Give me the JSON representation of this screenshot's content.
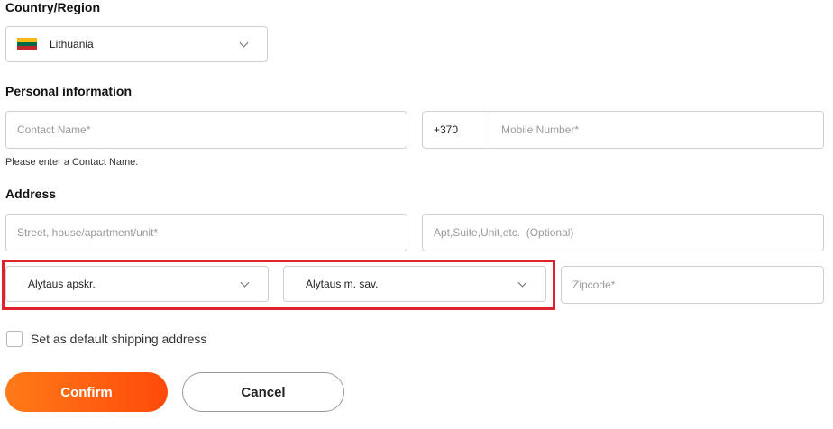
{
  "country": {
    "title": "Country/Region",
    "selected": "Lithuania",
    "flag_colors": [
      "#fdb913",
      "#006a44",
      "#c1272d"
    ]
  },
  "personal": {
    "title": "Personal information",
    "contact_name_placeholder": "Contact Name*",
    "phone_code": "+370",
    "mobile_placeholder": "Mobile Number*",
    "error_hint": "Please enter a Contact Name."
  },
  "address": {
    "title": "Address",
    "street_placeholder": "Street, house/apartment/unit*",
    "apt_placeholder": "Apt,Suite,Unit,etc.  (Optional)",
    "county_selected": "Alytaus apskr.",
    "municipality_selected": "Alytaus m. sav.",
    "zipcode_placeholder": "Zipcode*",
    "highlight_color": "#e0212e"
  },
  "default_shipping": {
    "label": "Set as default shipping address",
    "checked": false
  },
  "buttons": {
    "confirm": "Confirm",
    "cancel": "Cancel",
    "confirm_color": "#ff5a12"
  }
}
